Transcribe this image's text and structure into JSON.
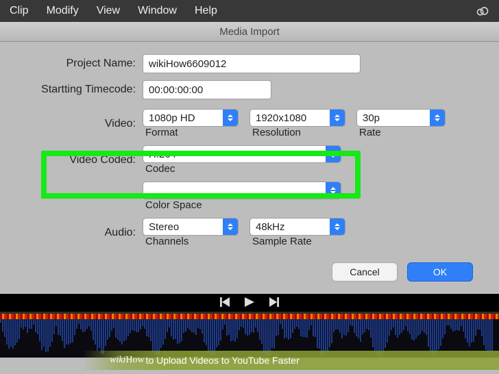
{
  "menu": {
    "items": [
      "Clip",
      "Modify",
      "View",
      "Window",
      "Help"
    ]
  },
  "dialog": {
    "title": "Media Import",
    "project_name_label": "Project Name:",
    "project_name_value": "wikiHow6609012",
    "timecode_label": "Startting Timecode:",
    "timecode_value": "00:00:00:00",
    "video_label": "Video:",
    "video": {
      "format": {
        "value": "1080p HD",
        "sublabel": "Format"
      },
      "resolution": {
        "value": "1920x1080",
        "sublabel": "Resolution"
      },
      "rate": {
        "value": "30p",
        "sublabel": "Rate"
      }
    },
    "codec_label": "Video Coded:",
    "codec": {
      "value": "H.264",
      "sublabel": "Codec"
    },
    "colorspace_label": "",
    "colorspace": {
      "value": "",
      "sublabel": "Color Space"
    },
    "audio_label": "Audio:",
    "audio": {
      "channels": {
        "value": "Stereo",
        "sublabel": "Channels"
      },
      "samplerate": {
        "value": "48kHz",
        "sublabel": "Sample Rate"
      }
    },
    "cancel": "Cancel",
    "ok": "OK"
  },
  "attribution": {
    "brand": "wikiHow",
    "title": "to Upload Videos to YouTube Faster"
  }
}
